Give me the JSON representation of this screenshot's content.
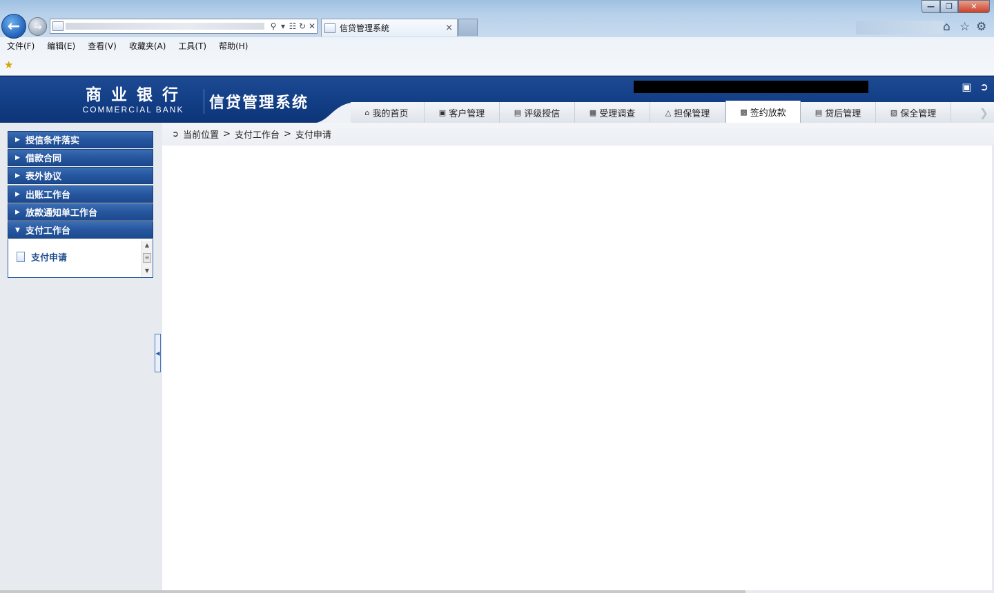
{
  "browser": {
    "tab_title": "信贷管理系统",
    "tab_close": "×",
    "menu": [
      "文件(F)",
      "编辑(E)",
      "查看(V)",
      "收藏夹(A)",
      "工具(T)",
      "帮助(H)"
    ],
    "icons": [
      "back-arrow-icon",
      "forward-arrow-icon",
      "search-icon",
      "refresh-icon",
      "stop-icon",
      "home-icon",
      "favorites-star-icon",
      "gear-icon"
    ]
  },
  "header": {
    "bank_name_cn": "商业银行",
    "bank_name_en": "COMMERCIAL BANK",
    "system_name": "信贷管理系统",
    "tabs": [
      {
        "label": "我的首页",
        "icon": "home-icon"
      },
      {
        "label": "客户管理",
        "icon": "customer-icon"
      },
      {
        "label": "评级授信",
        "icon": "rating-icon"
      },
      {
        "label": "受理调查",
        "icon": "survey-icon"
      },
      {
        "label": "担保管理",
        "icon": "guarantee-icon"
      },
      {
        "label": "签约放款",
        "icon": "contract-icon",
        "active": true
      },
      {
        "label": "贷后管理",
        "icon": "post-loan-icon"
      },
      {
        "label": "保全管理",
        "icon": "preservation-icon"
      }
    ]
  },
  "sidebar": {
    "items": [
      {
        "label": "授信条件落实",
        "expanded": false
      },
      {
        "label": "借款合同",
        "expanded": false
      },
      {
        "label": "表外协议",
        "expanded": false
      },
      {
        "label": "出账工作台",
        "expanded": false
      },
      {
        "label": "放款通知单工作台",
        "expanded": false
      },
      {
        "label": "支付工作台",
        "expanded": true
      }
    ],
    "sub_items": [
      {
        "label": "支付申请"
      }
    ]
  },
  "breadcrumb": {
    "prefix": "当前位置",
    "sep": ">",
    "path": [
      "支付工作台",
      "支付申请"
    ]
  },
  "colors": {
    "header_blue": "#123e86",
    "sidebar_item_blue": "#25569e",
    "content_bg": "#ffffff"
  }
}
